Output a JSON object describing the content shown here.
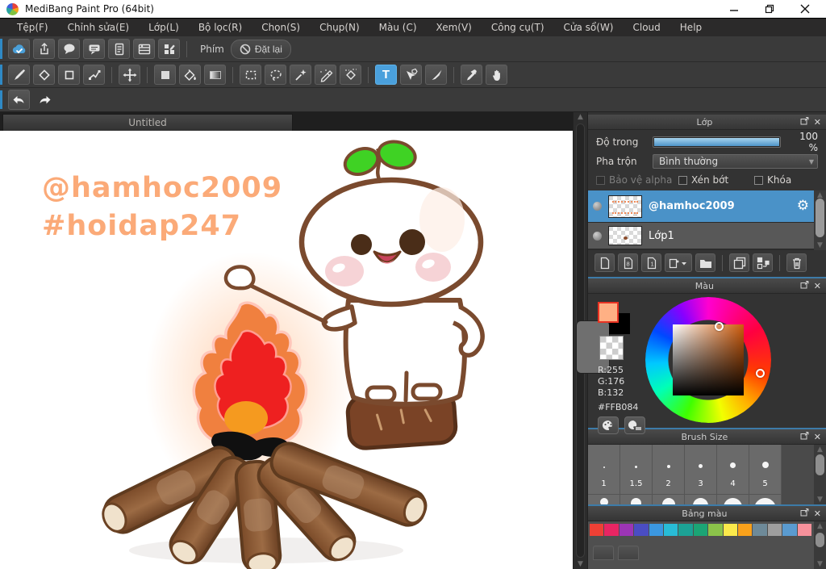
{
  "window": {
    "title": "MediBang Paint Pro (64bit)",
    "controls": [
      "minimize-icon",
      "restore-icon",
      "close-icon"
    ]
  },
  "menu": {
    "items": [
      "Tệp(F)",
      "Chỉnh sửa(E)",
      "Lớp(L)",
      "Bộ lọc(R)",
      "Chọn(S)",
      "Chụp(N)",
      "Màu (C)",
      "Xem(V)",
      "Công cụ(T)",
      "Cửa sổ(W)",
      "Cloud",
      "Help"
    ]
  },
  "quickbar": {
    "shortcut_label": "Phím",
    "reset_label": "Đặt lại",
    "icons": [
      "cloud-sync-icon",
      "share-icon",
      "comment-icon",
      "message-icon",
      "document-icon",
      "material-panel-icon",
      "layout-icon",
      "no-entry-icon"
    ]
  },
  "tools": {
    "active": "text",
    "text_glyph": "T",
    "names": [
      "brush",
      "eraser",
      "shape-brush",
      "polyline",
      "move",
      "fill-rect",
      "bucket",
      "gradient",
      "select-rect",
      "select-lasso",
      "magic-wand",
      "select-pen",
      "select-eraser",
      "text",
      "operation",
      "divide",
      "eyedropper",
      "hand",
      "undo",
      "redo"
    ]
  },
  "document": {
    "tab_title": "Untitled",
    "canvas_text_line1": "@hamhoc2009",
    "canvas_text_line2": "#hoidap247",
    "canvas_text_color": "#fbaa78"
  },
  "layers_panel": {
    "title": "Lớp",
    "opacity_label": "Độ trong",
    "opacity_value": "100 %",
    "blend_label": "Pha trộn",
    "blend_value": "Bình thường",
    "check_alpha": "Bảo vệ alpha",
    "check_clip": "Xén bớt",
    "check_lock": "Khóa",
    "layers": [
      {
        "name": "@hamhoc2009",
        "selected": true
      },
      {
        "name": "Lớp1",
        "selected": false
      }
    ],
    "tool_icons": [
      "new-layer-icon",
      "new-8bit-layer-icon",
      "new-1bit-layer-icon",
      "add-layer-menu-icon",
      "folder-icon",
      "duplicate-layer-icon",
      "merge-layer-icon",
      "delete-layer-icon"
    ]
  },
  "color_panel": {
    "title": "Màu",
    "r_label": "R:255",
    "g_label": "G:176",
    "b_label": "B:132",
    "hex_label": "#FFB084",
    "foreground": "#FFB084",
    "icons": [
      "palette-icon",
      "palette-hex-icon"
    ]
  },
  "brush_panel": {
    "title": "Brush Size",
    "sizes": [
      {
        "label": "1",
        "dot": 2
      },
      {
        "label": "1.5",
        "dot": 3
      },
      {
        "label": "2",
        "dot": 4
      },
      {
        "label": "3",
        "dot": 5
      },
      {
        "label": "4",
        "dot": 7
      },
      {
        "label": "5",
        "dot": 8
      }
    ],
    "row2_dots": [
      10,
      13,
      16,
      19,
      23,
      27
    ]
  },
  "palette_panel": {
    "title": "Bảng màu",
    "swatches": [
      "#ee4035",
      "#e82563",
      "#9c35b5",
      "#4a4dc3",
      "#3b97e0",
      "#28bcd6",
      "#1ca295",
      "#1ba575",
      "#8bc34a",
      "#fbe94b",
      "#f9a11b",
      "#6e8a99",
      "#9e9e9e",
      "#5a9bd0",
      "#f6919b"
    ]
  },
  "accent": {
    "selection_blue": "#4aa0dc",
    "layer_selected": "#4a92c8",
    "slider_fill": "#5fa8d8",
    "separator_blue": "#3d7ba8"
  },
  "panel_header_icons": [
    "popout-icon",
    "close-icon"
  ]
}
